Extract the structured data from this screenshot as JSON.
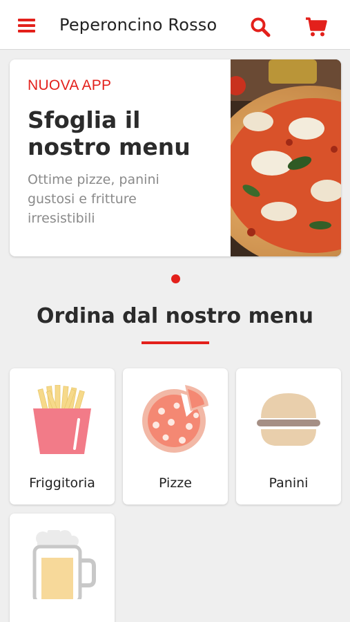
{
  "header": {
    "title": "Peperoncino Rosso",
    "menu_icon": "hamburger-menu-icon",
    "search_icon": "search-icon",
    "cart_icon": "cart-icon"
  },
  "hero": {
    "tag": "NUOVA APP",
    "title": "Sfoglia il nostro menu",
    "subtitle": "Ottime pizze, panini gustosi e fritture irresistibili"
  },
  "carousel": {
    "active_index": 0,
    "count": 1
  },
  "section": {
    "title": "Ordina dal nostro menu"
  },
  "categories": [
    {
      "label": "Friggitoria",
      "icon": "fries-icon"
    },
    {
      "label": "Pizze",
      "icon": "pizza-icon"
    },
    {
      "label": "Panini",
      "icon": "burger-icon"
    },
    {
      "label": "",
      "icon": "beer-icon"
    }
  ],
  "colors": {
    "accent": "#e3201b",
    "background": "#efefef",
    "card": "#ffffff"
  }
}
